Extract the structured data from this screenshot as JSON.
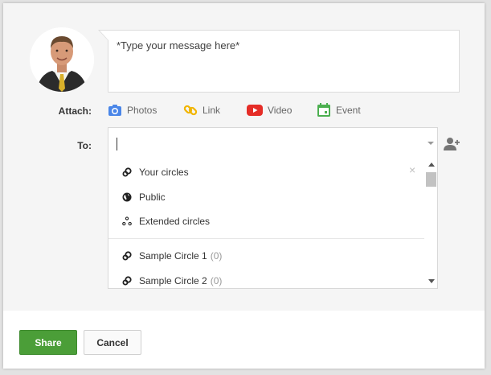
{
  "message": {
    "placeholder": "*Type your message here*"
  },
  "attach": {
    "label": "Attach:",
    "items": [
      {
        "name": "photos",
        "label": "Photos",
        "icon": "camera-icon",
        "color": "#4a86e8"
      },
      {
        "name": "link",
        "label": "Link",
        "icon": "link-icon",
        "color": "#f1b500"
      },
      {
        "name": "video",
        "label": "Video",
        "icon": "youtube-icon",
        "color": "#e52d27"
      },
      {
        "name": "event",
        "label": "Event",
        "icon": "calendar-icon",
        "color": "#4caf50"
      }
    ]
  },
  "to": {
    "label": "To:",
    "value": ""
  },
  "dropdown": {
    "close": "×",
    "items": [
      {
        "label": "Your circles",
        "icon": "circles-icon",
        "count": ""
      },
      {
        "label": "Public",
        "icon": "globe-icon",
        "count": ""
      },
      {
        "label": "Extended circles",
        "icon": "extended-circles-icon",
        "count": ""
      },
      {
        "label": "Sample Circle 1",
        "icon": "circles-icon",
        "count": "(0)"
      },
      {
        "label": "Sample Circle 2",
        "icon": "circles-icon",
        "count": "(0)"
      }
    ]
  },
  "footer": {
    "share_label": "Share",
    "cancel_label": "Cancel"
  },
  "colors": {
    "share_button": "#4b9e38"
  }
}
